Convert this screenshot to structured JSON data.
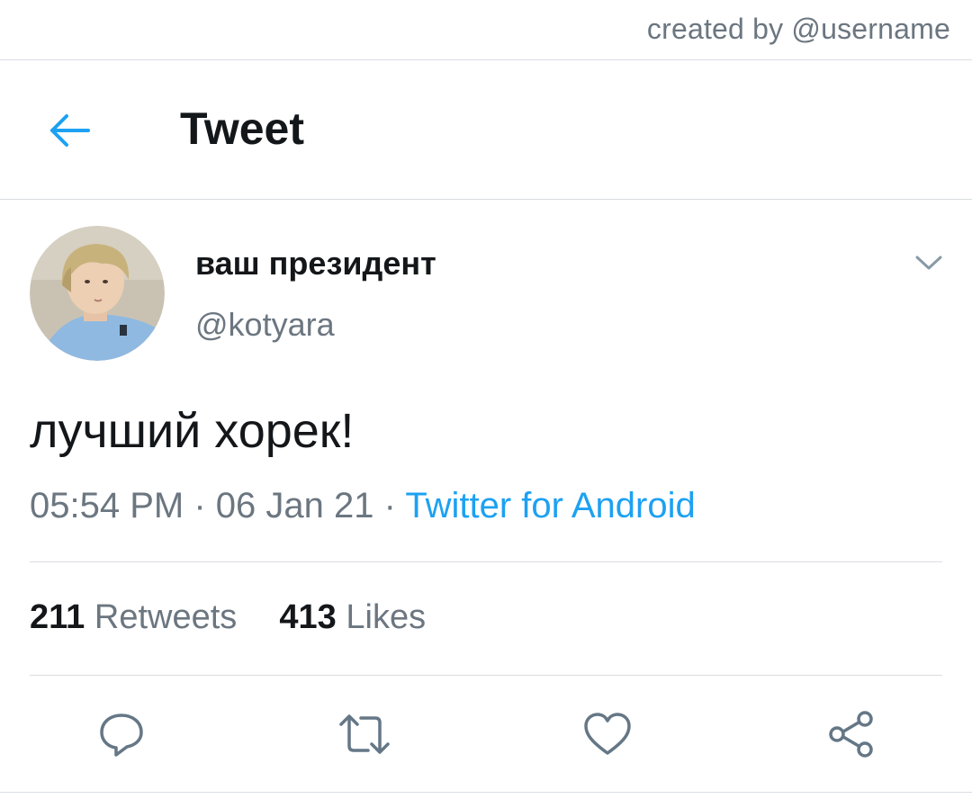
{
  "credit": "created by @username",
  "header": {
    "title": "Tweet"
  },
  "tweet": {
    "display_name": "ваш президент",
    "handle": "@kotyara",
    "text": "лучший хорек!",
    "time": "05:54 PM",
    "separator": "·",
    "date": "06 Jan 21",
    "source": "Twitter for Android",
    "retweets_count": "211",
    "retweets_label": "Retweets",
    "likes_count": "413",
    "likes_label": "Likes"
  },
  "icons": {
    "back": "arrow-left-icon",
    "more": "chevron-down-icon",
    "reply": "reply-icon",
    "retweet": "retweet-icon",
    "like": "heart-icon",
    "share": "share-icon"
  },
  "colors": {
    "accent": "#1da1f2",
    "text": "#14171a",
    "secondary": "#6b7680",
    "divider": "#d9dde1"
  }
}
